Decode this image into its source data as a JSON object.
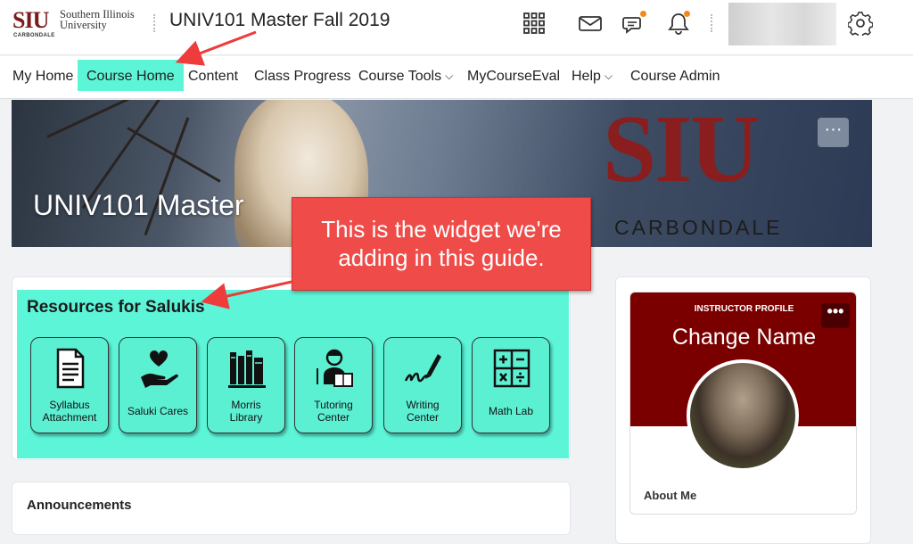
{
  "header": {
    "logo_siu": "SIU",
    "logo_name_line1": "Southern Illinois",
    "logo_name_line2": "University",
    "logo_carbondale": "CARBONDALE",
    "course_title": "UNIV101 Master Fall 2019",
    "icons": [
      "apps-grid-icon",
      "mail-icon",
      "chat-icon",
      "bell-icon",
      "gear-icon"
    ],
    "badge_color": "#f18a1d"
  },
  "nav": {
    "items": [
      {
        "label": "My Home"
      },
      {
        "label": "Course Home",
        "active": true
      },
      {
        "label": "Content"
      },
      {
        "label": "Class Progress"
      },
      {
        "label": "Course Tools",
        "dropdown": true
      },
      {
        "label": "MyCourseEval"
      },
      {
        "label": "Help",
        "dropdown": true
      },
      {
        "label": "Course Admin"
      }
    ],
    "active_color": "#5cf5d8"
  },
  "banner": {
    "title": "UNIV101 Master",
    "siu": "SIU",
    "carbondale": "CARBONDALE",
    "more": "···"
  },
  "callout": {
    "line1": "This is the widget we're",
    "line2": "adding in this guide."
  },
  "resources": {
    "title": "Resources for Salukis",
    "tiles": [
      {
        "line1": "Syllabus",
        "line2": "Attachment",
        "icon": "document-icon"
      },
      {
        "line1": "Saluki Cares",
        "line2": "",
        "icon": "heart-hand-icon"
      },
      {
        "line1": "Morris",
        "line2": "Library",
        "icon": "books-icon"
      },
      {
        "line1": "Tutoring",
        "line2": "Center",
        "icon": "tutor-icon"
      },
      {
        "line1": "Writing",
        "line2": "Center",
        "icon": "pen-icon"
      },
      {
        "line1": "Math Lab",
        "line2": "",
        "icon": "calculator-icon"
      }
    ]
  },
  "announcements": {
    "title": "Announcements"
  },
  "profile": {
    "label": "INSTRUCTOR PROFILE",
    "name": "Change Name",
    "more": "•••",
    "about": "About Me",
    "color": "#7a0000"
  }
}
